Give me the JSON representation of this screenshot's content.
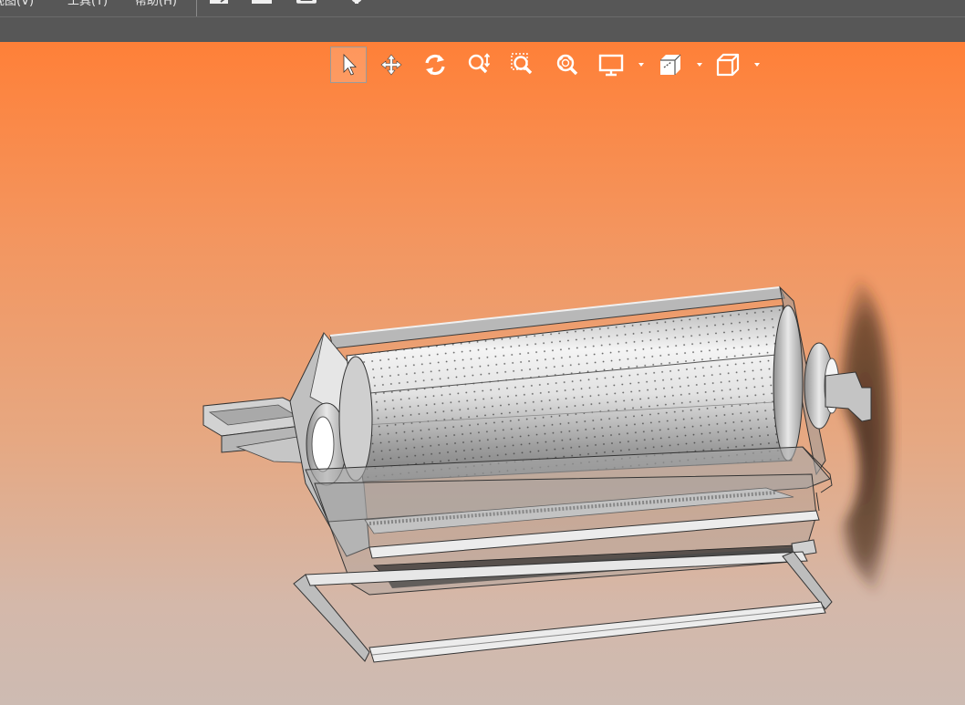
{
  "menubar": {
    "items": [
      {
        "label": "视图(V)"
      },
      {
        "label": "工具(T)"
      },
      {
        "label": "帮助(H)"
      }
    ],
    "quick_actions": [
      "open-icon",
      "save-icon",
      "print-icon",
      "settings-icon"
    ]
  },
  "toolbar": {
    "tools": [
      {
        "name": "select-tool",
        "icon": "cursor-arrow-icon",
        "active": true
      },
      {
        "name": "pan-tool",
        "icon": "move-arrows-icon"
      },
      {
        "name": "rotate-tool",
        "icon": "rotate-icon"
      },
      {
        "name": "zoom-tool",
        "icon": "zoom-vertical-icon"
      },
      {
        "name": "zoom-window-tool",
        "icon": "zoom-window-icon"
      },
      {
        "name": "zoom-fit-tool",
        "icon": "zoom-fit-icon"
      },
      {
        "name": "display-menu",
        "icon": "monitor-icon",
        "dropdown": true
      },
      {
        "name": "section-view-menu",
        "icon": "section-box-icon",
        "dropdown": true
      },
      {
        "name": "view-orientation-menu",
        "icon": "cube-icon",
        "dropdown": true
      }
    ]
  },
  "colors": {
    "chrome": "#575757",
    "viewport_top": "#ff8038",
    "viewport_bottom": "#cdbbb2",
    "icon": "#ffffff"
  }
}
